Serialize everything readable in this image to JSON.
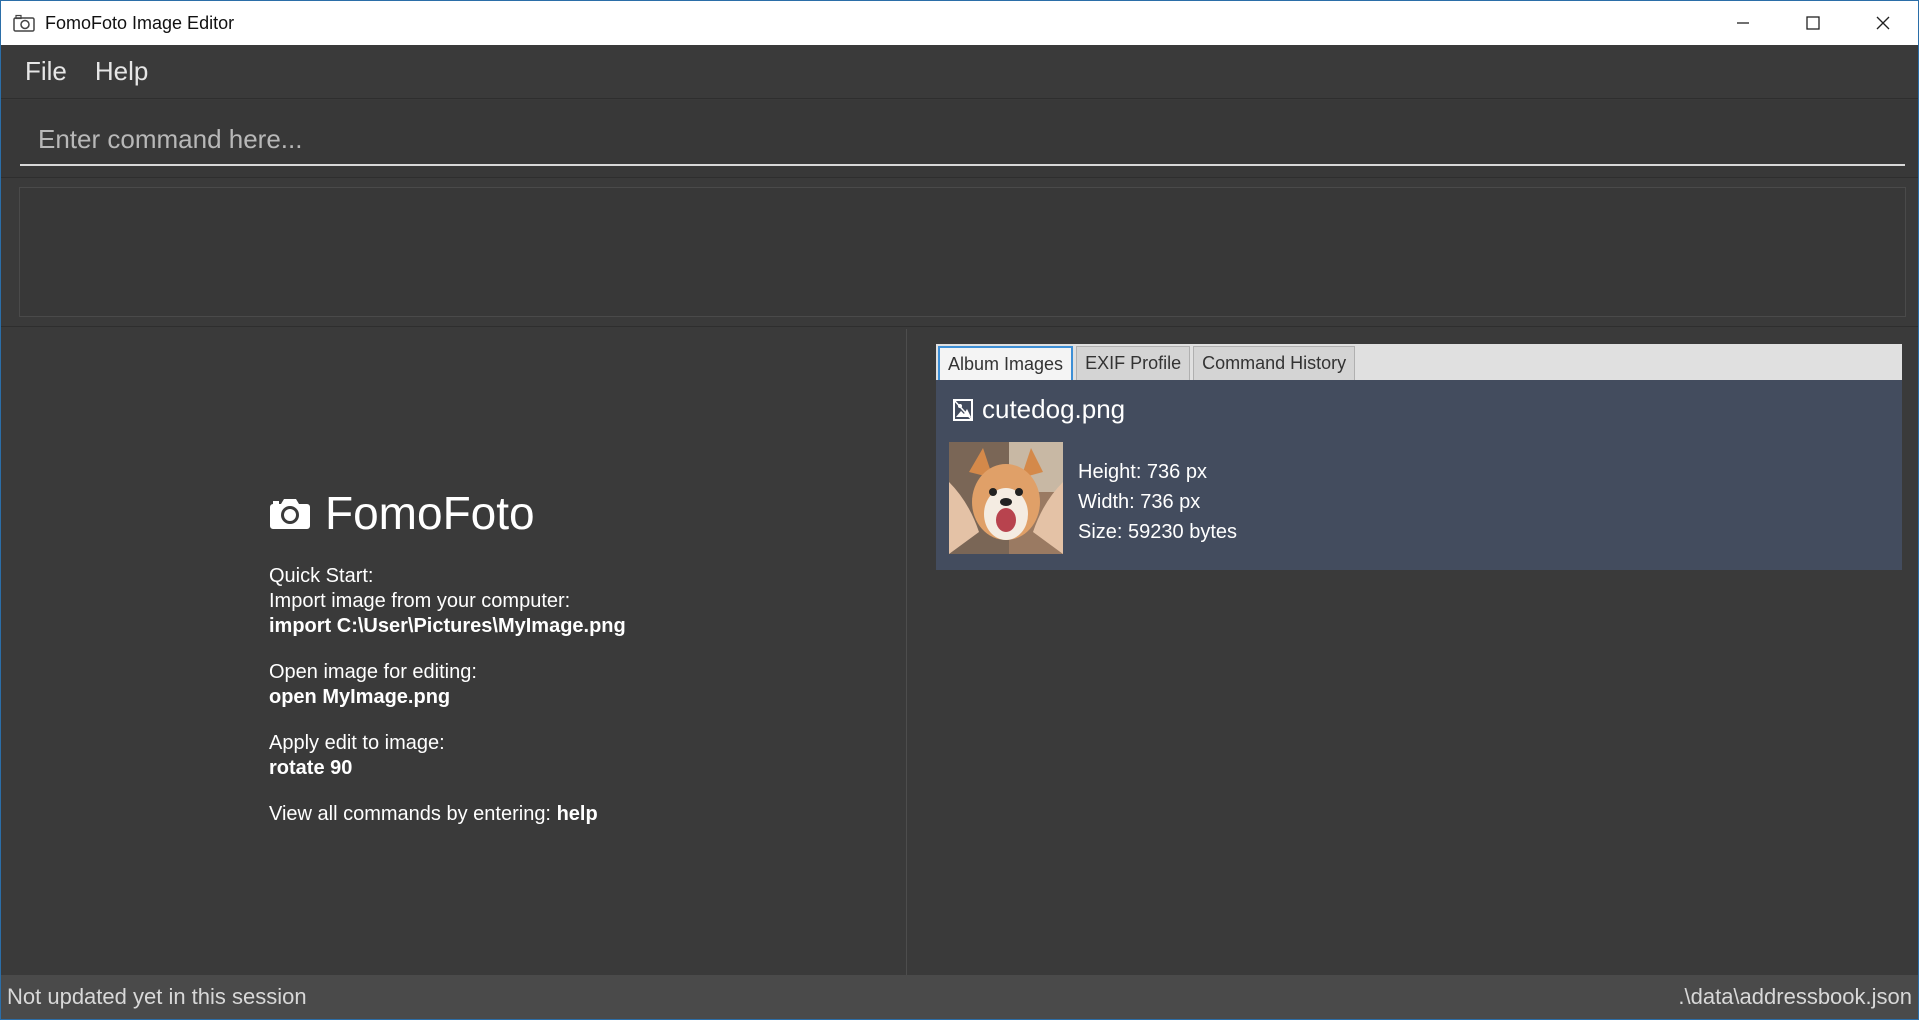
{
  "window": {
    "title": "FomoFoto Image Editor",
    "icon": "camera-icon",
    "controls": [
      "minimize-icon",
      "maximize-icon",
      "close-icon"
    ]
  },
  "menu": {
    "items": [
      "File",
      "Help"
    ]
  },
  "command": {
    "placeholder": "Enter command here...",
    "value": ""
  },
  "result": {
    "text": ""
  },
  "welcome": {
    "brand": "FomoFoto",
    "quick_start": "Quick Start:",
    "import_desc": "Import image from your computer:",
    "import_cmd": "import C:\\User\\Pictures\\MyImage.png",
    "open_desc": "Open image for editing:",
    "open_cmd": "open MyImage.png",
    "edit_desc": "Apply edit to image:",
    "edit_cmd": "rotate 90",
    "help_desc": "View all commands by entering: ",
    "help_cmd": "help"
  },
  "tabs": [
    {
      "label": "Album Images",
      "active": true
    },
    {
      "label": "EXIF Profile",
      "active": false
    },
    {
      "label": "Command History",
      "active": false
    }
  ],
  "album": {
    "images": [
      {
        "name": "cutedog.png",
        "height": "Height: 736 px",
        "width": "Width: 736 px",
        "size": "Size: 59230 bytes",
        "icon": "image-file-icon"
      }
    ]
  },
  "status": {
    "left": "Not updated yet in this session",
    "right": ".\\data\\addressbook.json"
  },
  "colors": {
    "background": "#3a3a3a",
    "card": "#434c5e",
    "tab_active_border": "#3d8fd6",
    "statusbar": "#4a4a4a"
  }
}
